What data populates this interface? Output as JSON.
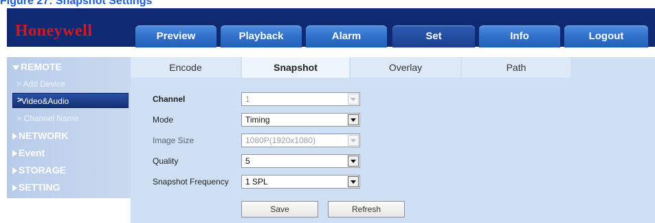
{
  "caption": "Figure 27: Snapshot Settings",
  "brand": {
    "logo_text": "Honeywell",
    "logo_color": "#d3191c"
  },
  "nav": {
    "tabs": [
      {
        "label": "Preview"
      },
      {
        "label": "Playback"
      },
      {
        "label": "Alarm"
      },
      {
        "label": "Set",
        "active": true
      },
      {
        "label": "Info"
      },
      {
        "label": "Logout"
      }
    ]
  },
  "sidebar": {
    "remote": "REMOTE",
    "add_device": "> Add Device",
    "video_audio": "Video&Audio",
    "channel_name": "> Channel Name",
    "network": "NETWORK",
    "event": "Event",
    "storage": "STORAGE",
    "setting": "SETTING"
  },
  "subtabs": [
    {
      "label": "Encode"
    },
    {
      "label": "Snapshot",
      "active": true
    },
    {
      "label": "Overlay"
    },
    {
      "label": "Path"
    }
  ],
  "form": {
    "channel": {
      "label": "Channel",
      "value": "1",
      "disabled": true
    },
    "mode": {
      "label": "Mode",
      "value": "Timing"
    },
    "image_size": {
      "label": "Image Size",
      "value": "1080P(1920x1080)",
      "disabled": true
    },
    "quality": {
      "label": "Quality",
      "value": "5"
    },
    "frequency": {
      "label": "Snapshot Frequency",
      "value": "1 SPL"
    }
  },
  "buttons": {
    "save": "Save",
    "refresh": "Refresh"
  },
  "colors": {
    "topbar": "#0f2a72",
    "accent": "#2f6ec8",
    "content_bg": "#cfe0f4"
  }
}
